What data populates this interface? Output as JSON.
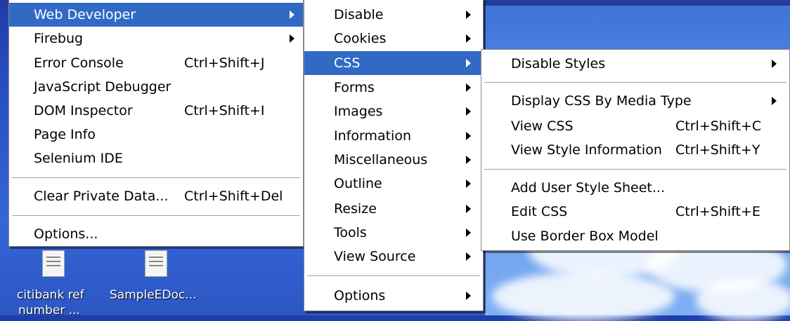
{
  "menu_main": {
    "items": [
      {
        "label": "Web Developer",
        "shortcut": "",
        "submenu": true,
        "active": true
      },
      {
        "label": "Firebug",
        "shortcut": "",
        "submenu": true
      },
      {
        "label": "Error Console",
        "shortcut": "Ctrl+Shift+J"
      },
      {
        "label": "JavaScript Debugger",
        "shortcut": ""
      },
      {
        "label": "DOM Inspector",
        "shortcut": "Ctrl+Shift+I"
      },
      {
        "label": "Page Info",
        "shortcut": ""
      },
      {
        "label": "Selenium IDE",
        "shortcut": ""
      },
      {
        "label": "Clear Private Data...",
        "shortcut": "Ctrl+Shift+Del"
      },
      {
        "label": "Options...",
        "shortcut": ""
      }
    ]
  },
  "menu_webdev": {
    "items": [
      {
        "label": "Disable"
      },
      {
        "label": "Cookies"
      },
      {
        "label": "CSS",
        "active": true
      },
      {
        "label": "Forms"
      },
      {
        "label": "Images"
      },
      {
        "label": "Information"
      },
      {
        "label": "Miscellaneous"
      },
      {
        "label": "Outline"
      },
      {
        "label": "Resize"
      },
      {
        "label": "Tools"
      },
      {
        "label": "View Source"
      },
      {
        "label": "Options"
      }
    ]
  },
  "menu_css": {
    "items": [
      {
        "label": "Disable Styles",
        "shortcut": "",
        "submenu": true
      },
      {
        "label": "Display CSS By Media Type",
        "shortcut": "",
        "submenu": true
      },
      {
        "label": "View CSS",
        "shortcut": "Ctrl+Shift+C"
      },
      {
        "label": "View Style Information",
        "shortcut": "Ctrl+Shift+Y"
      },
      {
        "label": "Add User Style Sheet...",
        "shortcut": ""
      },
      {
        "label": "Edit CSS",
        "shortcut": "Ctrl+Shift+E"
      },
      {
        "label": "Use Border Box Model",
        "shortcut": ""
      }
    ]
  },
  "desktop": {
    "icons": [
      {
        "label": "citibank ref",
        "label2": "number ..."
      },
      {
        "label": "SampleEDoc..."
      }
    ]
  },
  "colors": {
    "highlight": "#316ac5",
    "menu_bg": "#ffffff"
  }
}
